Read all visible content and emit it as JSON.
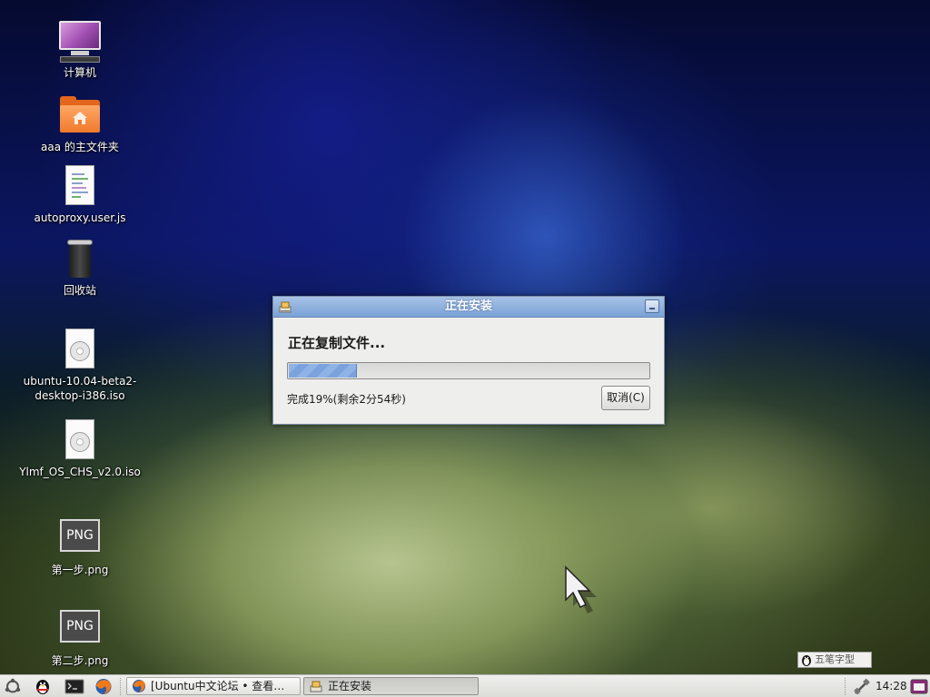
{
  "desktop": {
    "icons": [
      {
        "label": "计算机",
        "icon": "computer-icon"
      },
      {
        "label": "aaa 的主文件夹",
        "icon": "home-folder-icon"
      },
      {
        "label": "autoproxy.user.js",
        "icon": "text-file-icon"
      },
      {
        "label": "回收站",
        "icon": "trash-icon"
      },
      {
        "label": "ubuntu-10.04-beta2-\ndesktop-i386.iso",
        "icon": "disc-image-icon"
      },
      {
        "label": "Ylmf_OS_CHS_v2.0.iso",
        "icon": "disc-image-icon"
      },
      {
        "label": "第一步.png",
        "icon": "png-image-icon",
        "badge": "PNG"
      },
      {
        "label": "第二步.png",
        "icon": "png-image-icon",
        "badge": "PNG"
      }
    ]
  },
  "dialog": {
    "title": "正在安装",
    "heading": "正在复制文件...",
    "progress_percent": 19,
    "status": "完成19%(剩余2分54秒)",
    "cancel_label": "取消(C)"
  },
  "ime": {
    "label": "五笔字型"
  },
  "taskbar": {
    "launchers": [
      "ubuntu-menu-icon",
      "qq-icon",
      "terminal-icon",
      "firefox-icon"
    ],
    "windows": [
      {
        "label": "[Ubuntu中文论坛 • 查看…",
        "icon": "firefox-icon",
        "active": false
      },
      {
        "label": "正在安装",
        "icon": "installer-icon",
        "active": true
      }
    ],
    "clock": "14:28"
  },
  "colors": {
    "titlebar": "#7aa2d6",
    "progress_fill": "#8fb3e6",
    "dialog_bg": "#eeeeec"
  }
}
